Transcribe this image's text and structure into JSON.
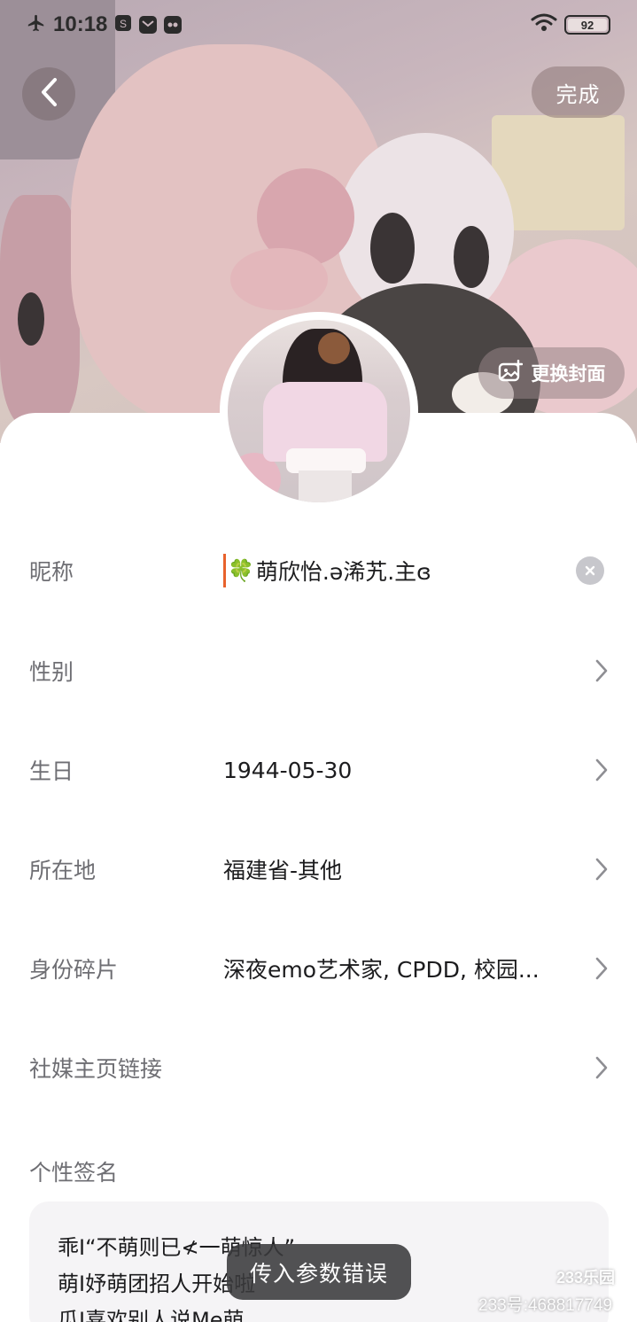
{
  "status_bar": {
    "time": "10:18",
    "battery": "92",
    "icons": [
      "airplane-icon",
      "notification-icon",
      "message-icon",
      "app-icon",
      "wifi-icon",
      "battery-icon"
    ]
  },
  "header": {
    "back_icon": "chevron-left-icon",
    "done_label": "完成",
    "change_cover_label": "更换封面",
    "change_cover_icon": "image-plus-icon"
  },
  "profile": {
    "fields": {
      "nickname": {
        "label": "昵称",
        "value": "萌欣怡.ə浠艽.主ɞ",
        "prefix_icon": "clover-icon",
        "clear_icon": "clear-icon"
      },
      "gender": {
        "label": "性别",
        "value": ""
      },
      "birthday": {
        "label": "生日",
        "value": "1944-05-30"
      },
      "location": {
        "label": "所在地",
        "value": "福建省-其他"
      },
      "identity": {
        "label": "身份碎片",
        "value": "深夜emo艺术家, CPDD, 校园..."
      },
      "social_link": {
        "label": "社媒主页链接",
        "value": ""
      }
    },
    "signature": {
      "label": "个性签名",
      "lines": [
        "乖I“不萌则已≮一萌惊人”",
        "萌I妤萌团招人开始啦",
        "瓜I喜欢别人说Me萌"
      ]
    }
  },
  "toast": {
    "text": "传入参数错误"
  },
  "watermark": {
    "logo": "233乐园",
    "id": "233号:468817749"
  },
  "colors": {
    "caret": "#e8622c",
    "label": "#6e6e73",
    "text": "#1c1c1e",
    "clear": "#c7c7cc"
  }
}
